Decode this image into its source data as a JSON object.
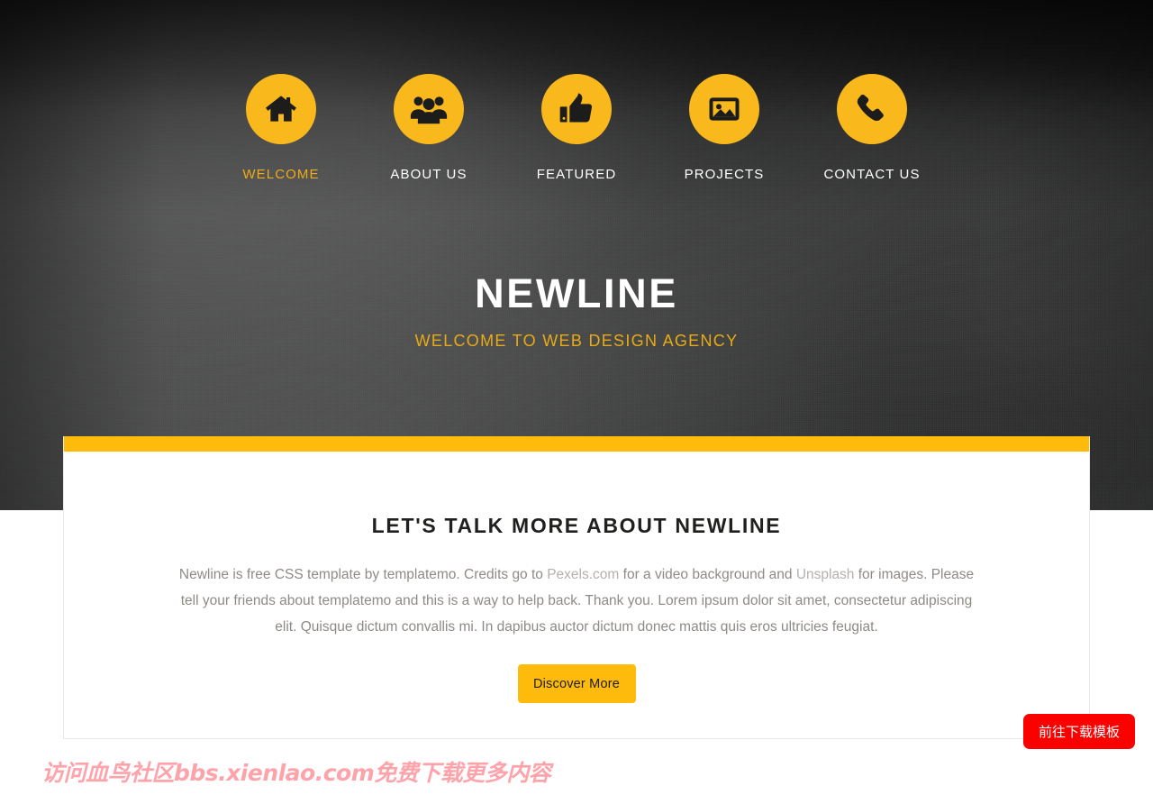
{
  "colors": {
    "accent_yellow": "#ffbb0c",
    "icon_circle": "#f9b81b",
    "active_nav": "#f0ac14",
    "hero_subtitle": "#e8ab16",
    "body_text": "#8e8a86",
    "badge_red": "#fc0000",
    "watermark_pink": "#ffa3ab",
    "video_bg_dark": "#0b0b0c"
  },
  "nav": {
    "items": [
      {
        "label": "WELCOME",
        "icon": "home-icon",
        "active": true
      },
      {
        "label": "ABOUT US",
        "icon": "users-group-icon",
        "active": false
      },
      {
        "label": "FEATURED",
        "icon": "thumbs-up-icon",
        "active": false
      },
      {
        "label": "PROJECTS",
        "icon": "image-picture-icon",
        "active": false
      },
      {
        "label": "CONTACT US",
        "icon": "phone-icon",
        "active": false
      }
    ]
  },
  "hero": {
    "title": "NEWLINE",
    "subtitle": "WELCOME TO WEB DESIGN AGENCY"
  },
  "about": {
    "heading": "LET'S TALK MORE ABOUT NEWLINE",
    "paragraph_part_1": "Newline is free CSS template by templatemo. Credits go to ",
    "link_1": "Pexels.com",
    "paragraph_part_2": " for a video background and ",
    "link_2": "Unsplash",
    "paragraph_part_3": " for images. Please tell your friends about templatemo and this is a way to help back. Thank you. Lorem ipsum dolor sit amet, consectetur adipiscing elit. Quisque dictum convallis mi. In dapibus auctor dictum donec mattis quis eros ultricies feugiat.",
    "button_label": "Discover More"
  },
  "overlays": {
    "watermark": "访问血鸟社区bbs.xienlao.com免费下载更多内容",
    "download_badge": "前往下载模板"
  }
}
